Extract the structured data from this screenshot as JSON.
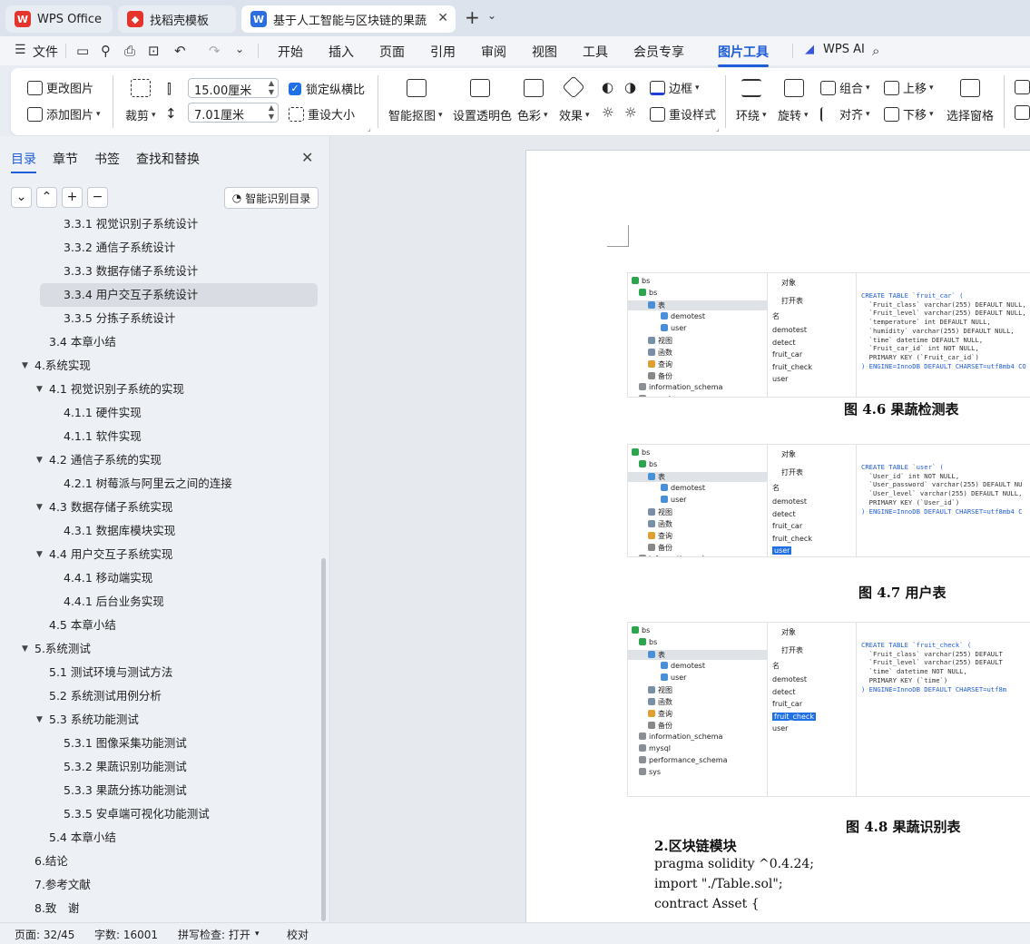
{
  "tabs": [
    {
      "label": "WPS Office",
      "icon": "wps-logo-icon",
      "color": "#e5342c"
    },
    {
      "label": "找稻壳模板",
      "icon": "docer-icon",
      "color": "#e5342c"
    },
    {
      "label": "基于人工智能与区块链的果蔬",
      "icon": "word-doc-icon",
      "color": "#2c6ee0"
    }
  ],
  "menu": {
    "file": "文件",
    "items": [
      "开始",
      "插入",
      "页面",
      "引用",
      "审阅",
      "视图",
      "工具",
      "会员专享",
      "图片工具"
    ],
    "active": "图片工具",
    "wps_ai": "WPS AI"
  },
  "ribbon": {
    "change_image": "更改图片",
    "add_image": "添加图片",
    "crop": "裁剪",
    "width_value": "15.00厘米",
    "height_value": "7.01厘米",
    "lock_ratio": "锁定纵横比",
    "resize": "重设大小",
    "smart_cutout": "智能抠图",
    "set_transparent": "设置透明色",
    "color": "色彩",
    "effects": "效果",
    "border": "边框",
    "reset_style": "重设样式",
    "wrap": "环绕",
    "rotate": "旋转",
    "group": "组合",
    "align": "对齐",
    "bring_forward": "上移",
    "send_backward": "下移",
    "select_pane": "选择窗格"
  },
  "panel": {
    "tabs": [
      "目录",
      "章节",
      "书签",
      "查找和替换"
    ],
    "smart_toc": "智能识别目录",
    "toc": [
      {
        "text": "3.3.1 视觉识别子系统设计",
        "level": 3,
        "arrow": false,
        "selected": false
      },
      {
        "text": "3.3.2 通信子系统设计",
        "level": 3,
        "arrow": false,
        "selected": false
      },
      {
        "text": "3.3.3 数据存储子系统设计",
        "level": 3,
        "arrow": false,
        "selected": false
      },
      {
        "text": "3.3.4 用户交互子系统设计",
        "level": 3,
        "arrow": false,
        "selected": true
      },
      {
        "text": "3.3.5 分拣子系统设计",
        "level": 3,
        "arrow": false,
        "selected": false
      },
      {
        "text": "3.4 本章小结",
        "level": 2,
        "arrow": false,
        "selected": false
      },
      {
        "text": "4.系统实现",
        "level": 1,
        "arrow": true,
        "selected": false
      },
      {
        "text": "4.1 视觉识别子系统的实现",
        "level": 2,
        "arrow": true,
        "selected": false
      },
      {
        "text": "4.1.1 硬件实现",
        "level": 3,
        "arrow": false,
        "selected": false
      },
      {
        "text": "4.1.1 软件实现",
        "level": 3,
        "arrow": false,
        "selected": false
      },
      {
        "text": "4.2 通信子系统的实现",
        "level": 2,
        "arrow": true,
        "selected": false
      },
      {
        "text": "4.2.1 树莓派与阿里云之间的连接",
        "level": 3,
        "arrow": false,
        "selected": false
      },
      {
        "text": "4.3 数据存储子系统实现",
        "level": 2,
        "arrow": true,
        "selected": false
      },
      {
        "text": "4.3.1 数据库模块实现",
        "level": 3,
        "arrow": false,
        "selected": false
      },
      {
        "text": "4.4 用户交互子系统实现",
        "level": 2,
        "arrow": true,
        "selected": false
      },
      {
        "text": "4.4.1 移动端实现",
        "level": 3,
        "arrow": false,
        "selected": false
      },
      {
        "text": "4.4.1 后台业务实现",
        "level": 3,
        "arrow": false,
        "selected": false
      },
      {
        "text": "4.5 本章小结",
        "level": 2,
        "arrow": false,
        "selected": false
      },
      {
        "text": "5.系统测试",
        "level": 1,
        "arrow": true,
        "selected": false
      },
      {
        "text": "5.1 测试环境与测试方法",
        "level": 2,
        "arrow": false,
        "selected": false
      },
      {
        "text": "5.2 系统测试用例分析",
        "level": 2,
        "arrow": false,
        "selected": false
      },
      {
        "text": "5.3 系统功能测试",
        "level": 2,
        "arrow": true,
        "selected": false
      },
      {
        "text": "5.3.1 图像采集功能测试",
        "level": 3,
        "arrow": false,
        "selected": false
      },
      {
        "text": "5.3.2 果蔬识别功能测试",
        "level": 3,
        "arrow": false,
        "selected": false
      },
      {
        "text": "5.3.3 果蔬分拣功能测试",
        "level": 3,
        "arrow": false,
        "selected": false
      },
      {
        "text": "5.3.5 安卓端可视化功能测试",
        "level": 3,
        "arrow": false,
        "selected": false
      },
      {
        "text": "5.4 本章小结",
        "level": 2,
        "arrow": false,
        "selected": false
      },
      {
        "text": "6.结论",
        "level": 1,
        "arrow": false,
        "selected": false
      },
      {
        "text": "7.参考文献",
        "level": 1,
        "arrow": false,
        "selected": false
      },
      {
        "text": "8.致　谢",
        "level": 1,
        "arrow": false,
        "selected": false
      }
    ]
  },
  "document": {
    "figures": [
      {
        "caption": "图 4.6  果蔬检测表",
        "tree": {
          "root": "bs",
          "db": "bs",
          "tables_label": "表",
          "tables": [
            "demotest",
            "user"
          ],
          "views": "视图",
          "funcs": "函数",
          "queries": "查询",
          "backups": "备份",
          "other_dbs": [
            "information_schema",
            "mysql"
          ]
        },
        "objects": {
          "header": "对象",
          "open": "打开表",
          "name_col": "名",
          "items": [
            "demotest",
            "detect",
            "fruit_car",
            "fruit_check",
            "user"
          ],
          "selected": ""
        },
        "sql": [
          "CREATE TABLE `fruit_car` (",
          "  `Fruit_class` varchar(255) DEFAULT NULL,",
          "  `Fruit_level` varchar(255) DEFAULT NULL,",
          "  `temperature` int DEFAULT NULL,",
          "  `humidity` varchar(255) DEFAULT NULL,",
          "  `time` datetime DEFAULT NULL,",
          "  `Fruit_car_id` int NOT NULL,",
          "  PRIMARY KEY (`Fruit_car_id`)",
          ") ENGINE=InnoDB DEFAULT CHARSET=utf8mb4 CO"
        ]
      },
      {
        "caption": "图 4.7  用户表",
        "tree": {
          "root": "bs",
          "db": "bs",
          "tables_label": "表",
          "tables": [
            "demotest",
            "user"
          ],
          "views": "视图",
          "funcs": "函数",
          "queries": "查询",
          "backups": "备份",
          "other_dbs": [
            "information_schema"
          ]
        },
        "objects": {
          "header": "对象",
          "open": "打开表",
          "name_col": "名",
          "items": [
            "demotest",
            "detect",
            "fruit_car",
            "fruit_check",
            "user"
          ],
          "selected": "user"
        },
        "sql": [
          "CREATE TABLE `user` (",
          "  `User_id` int NOT NULL,",
          "  `User_password` varchar(255) DEFAULT NU",
          "  `User_level` varchar(255) DEFAULT NULL,",
          "  PRIMARY KEY (`User_id`)",
          ") ENGINE=InnoDB DEFAULT CHARSET=utf8mb4 C"
        ]
      },
      {
        "caption": "图 4.8 果蔬识别表",
        "tree": {
          "root": "bs",
          "db": "bs",
          "tables_label": "表",
          "tables": [
            "demotest",
            "user"
          ],
          "views": "视图",
          "funcs": "函数",
          "queries": "查询",
          "backups": "备份",
          "other_dbs": [
            "information_schema",
            "mysql",
            "performance_schema",
            "sys"
          ]
        },
        "objects": {
          "header": "对象",
          "open": "打开表",
          "name_col": "名",
          "items": [
            "demotest",
            "detect",
            "fruit_car",
            "fruit_check",
            "user"
          ],
          "selected": "fruit_check"
        },
        "sql": [
          "CREATE TABLE `fruit_check` (",
          "  `Fruit_class` varchar(255) DEFAULT",
          "  `Fruit_level` varchar(255) DEFAULT",
          "  `time` datetime NOT NULL,",
          "  PRIMARY KEY (`time`)",
          ") ENGINE=InnoDB DEFAULT CHARSET=utf8m"
        ]
      }
    ],
    "heading": "2.区块链模块",
    "code_lines": [
      "pragma solidity ^0.4.24;",
      "import \"./Table.sol\";",
      "contract Asset {"
    ]
  },
  "status": {
    "page": "页面: 32/45",
    "words": "字数: 16001",
    "spell": "拼写检查: 打开",
    "proof": "校对"
  }
}
